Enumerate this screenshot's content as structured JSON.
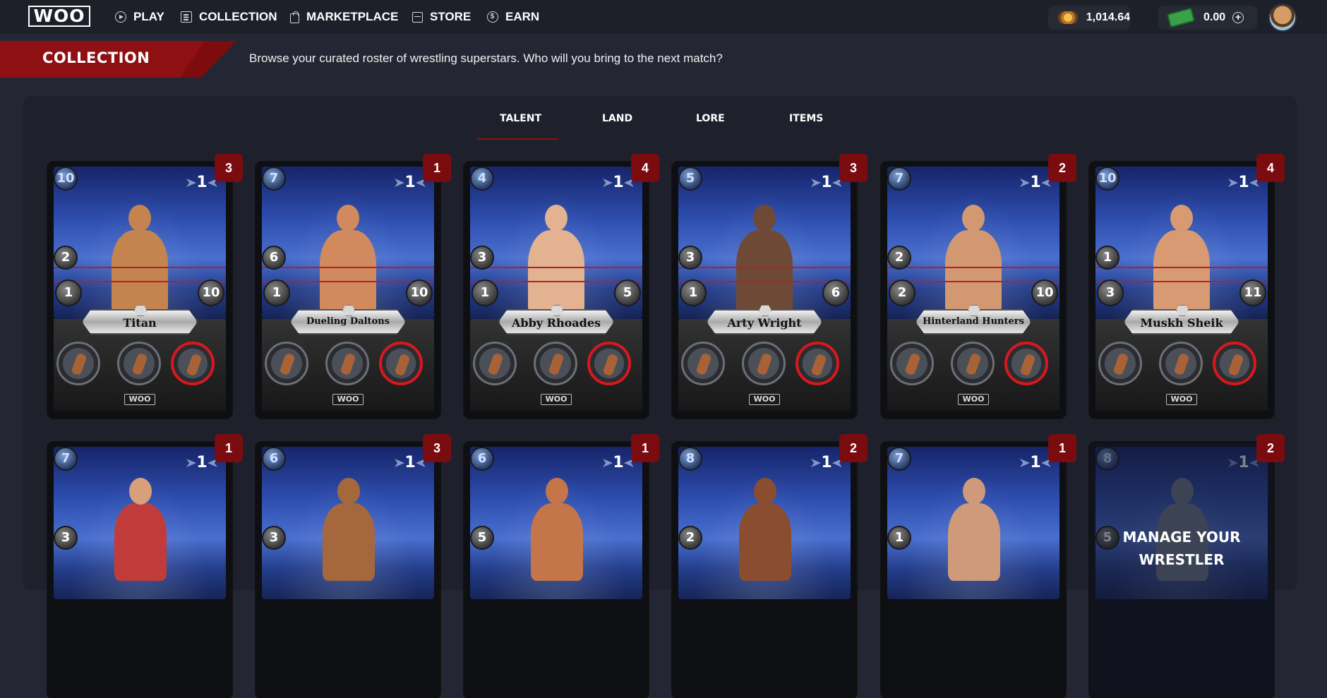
{
  "nav": {
    "logo": "WOO",
    "items": [
      {
        "label": "PLAY",
        "icon": "play-icon"
      },
      {
        "label": "COLLECTION",
        "icon": "collection-icon"
      },
      {
        "label": "MARKETPLACE",
        "icon": "bag-icon"
      },
      {
        "label": "STORE",
        "icon": "store-icon"
      },
      {
        "label": "EARN",
        "icon": "dollar-icon"
      }
    ],
    "balances": {
      "championship_belt": "1,014.64",
      "cash": "0.00"
    }
  },
  "header": {
    "title": "COLLECTION",
    "subtitle": "Browse your curated roster of wrestling superstars. Who will you bring to the next match?"
  },
  "tabs": [
    {
      "label": "TALENT",
      "active": true
    },
    {
      "label": "LAND",
      "active": false
    },
    {
      "label": "LORE",
      "active": false
    },
    {
      "label": "ITEMS",
      "active": false
    }
  ],
  "cards_row1": [
    {
      "name": "Titan",
      "cost": "10",
      "level": "1",
      "stat_a": "2",
      "stat_b": "1",
      "stat_c": "10",
      "quantity": "3",
      "badge": "WOO"
    },
    {
      "name": "Dueling Daltons",
      "cost": "7",
      "level": "1",
      "stat_a": "6",
      "stat_b": "1",
      "stat_c": "10",
      "quantity": "1",
      "badge": "WOO"
    },
    {
      "name": "Abby Rhoades",
      "cost": "4",
      "level": "1",
      "stat_a": "3",
      "stat_b": "1",
      "stat_c": "5",
      "quantity": "4",
      "badge": "WOO"
    },
    {
      "name": "Arty Wright",
      "cost": "5",
      "level": "1",
      "stat_a": "3",
      "stat_b": "1",
      "stat_c": "6",
      "quantity": "3",
      "badge": "WOO"
    },
    {
      "name": "Hinterland Hunters",
      "cost": "7",
      "level": "1",
      "stat_a": "2",
      "stat_b": "2",
      "stat_c": "10",
      "quantity": "2",
      "badge": "WOO"
    },
    {
      "name": "Muskh Sheik",
      "cost": "10",
      "level": "1",
      "stat_a": "1",
      "stat_b": "3",
      "stat_c": "11",
      "quantity": "4",
      "badge": "WOO"
    }
  ],
  "cards_row2": [
    {
      "cost": "7",
      "level": "1",
      "stat_a": "3",
      "quantity": "1"
    },
    {
      "cost": "6",
      "level": "1",
      "stat_a": "3",
      "quantity": "3"
    },
    {
      "cost": "6",
      "level": "1",
      "stat_a": "5",
      "quantity": "1"
    },
    {
      "cost": "8",
      "level": "1",
      "stat_a": "2",
      "quantity": "2"
    },
    {
      "cost": "7",
      "level": "1",
      "stat_a": "1",
      "quantity": "1"
    },
    {
      "cost": "8",
      "level": "1",
      "stat_a": "5",
      "quantity": "2",
      "overlay": "MANAGE YOUR WRESTLER"
    }
  ]
}
